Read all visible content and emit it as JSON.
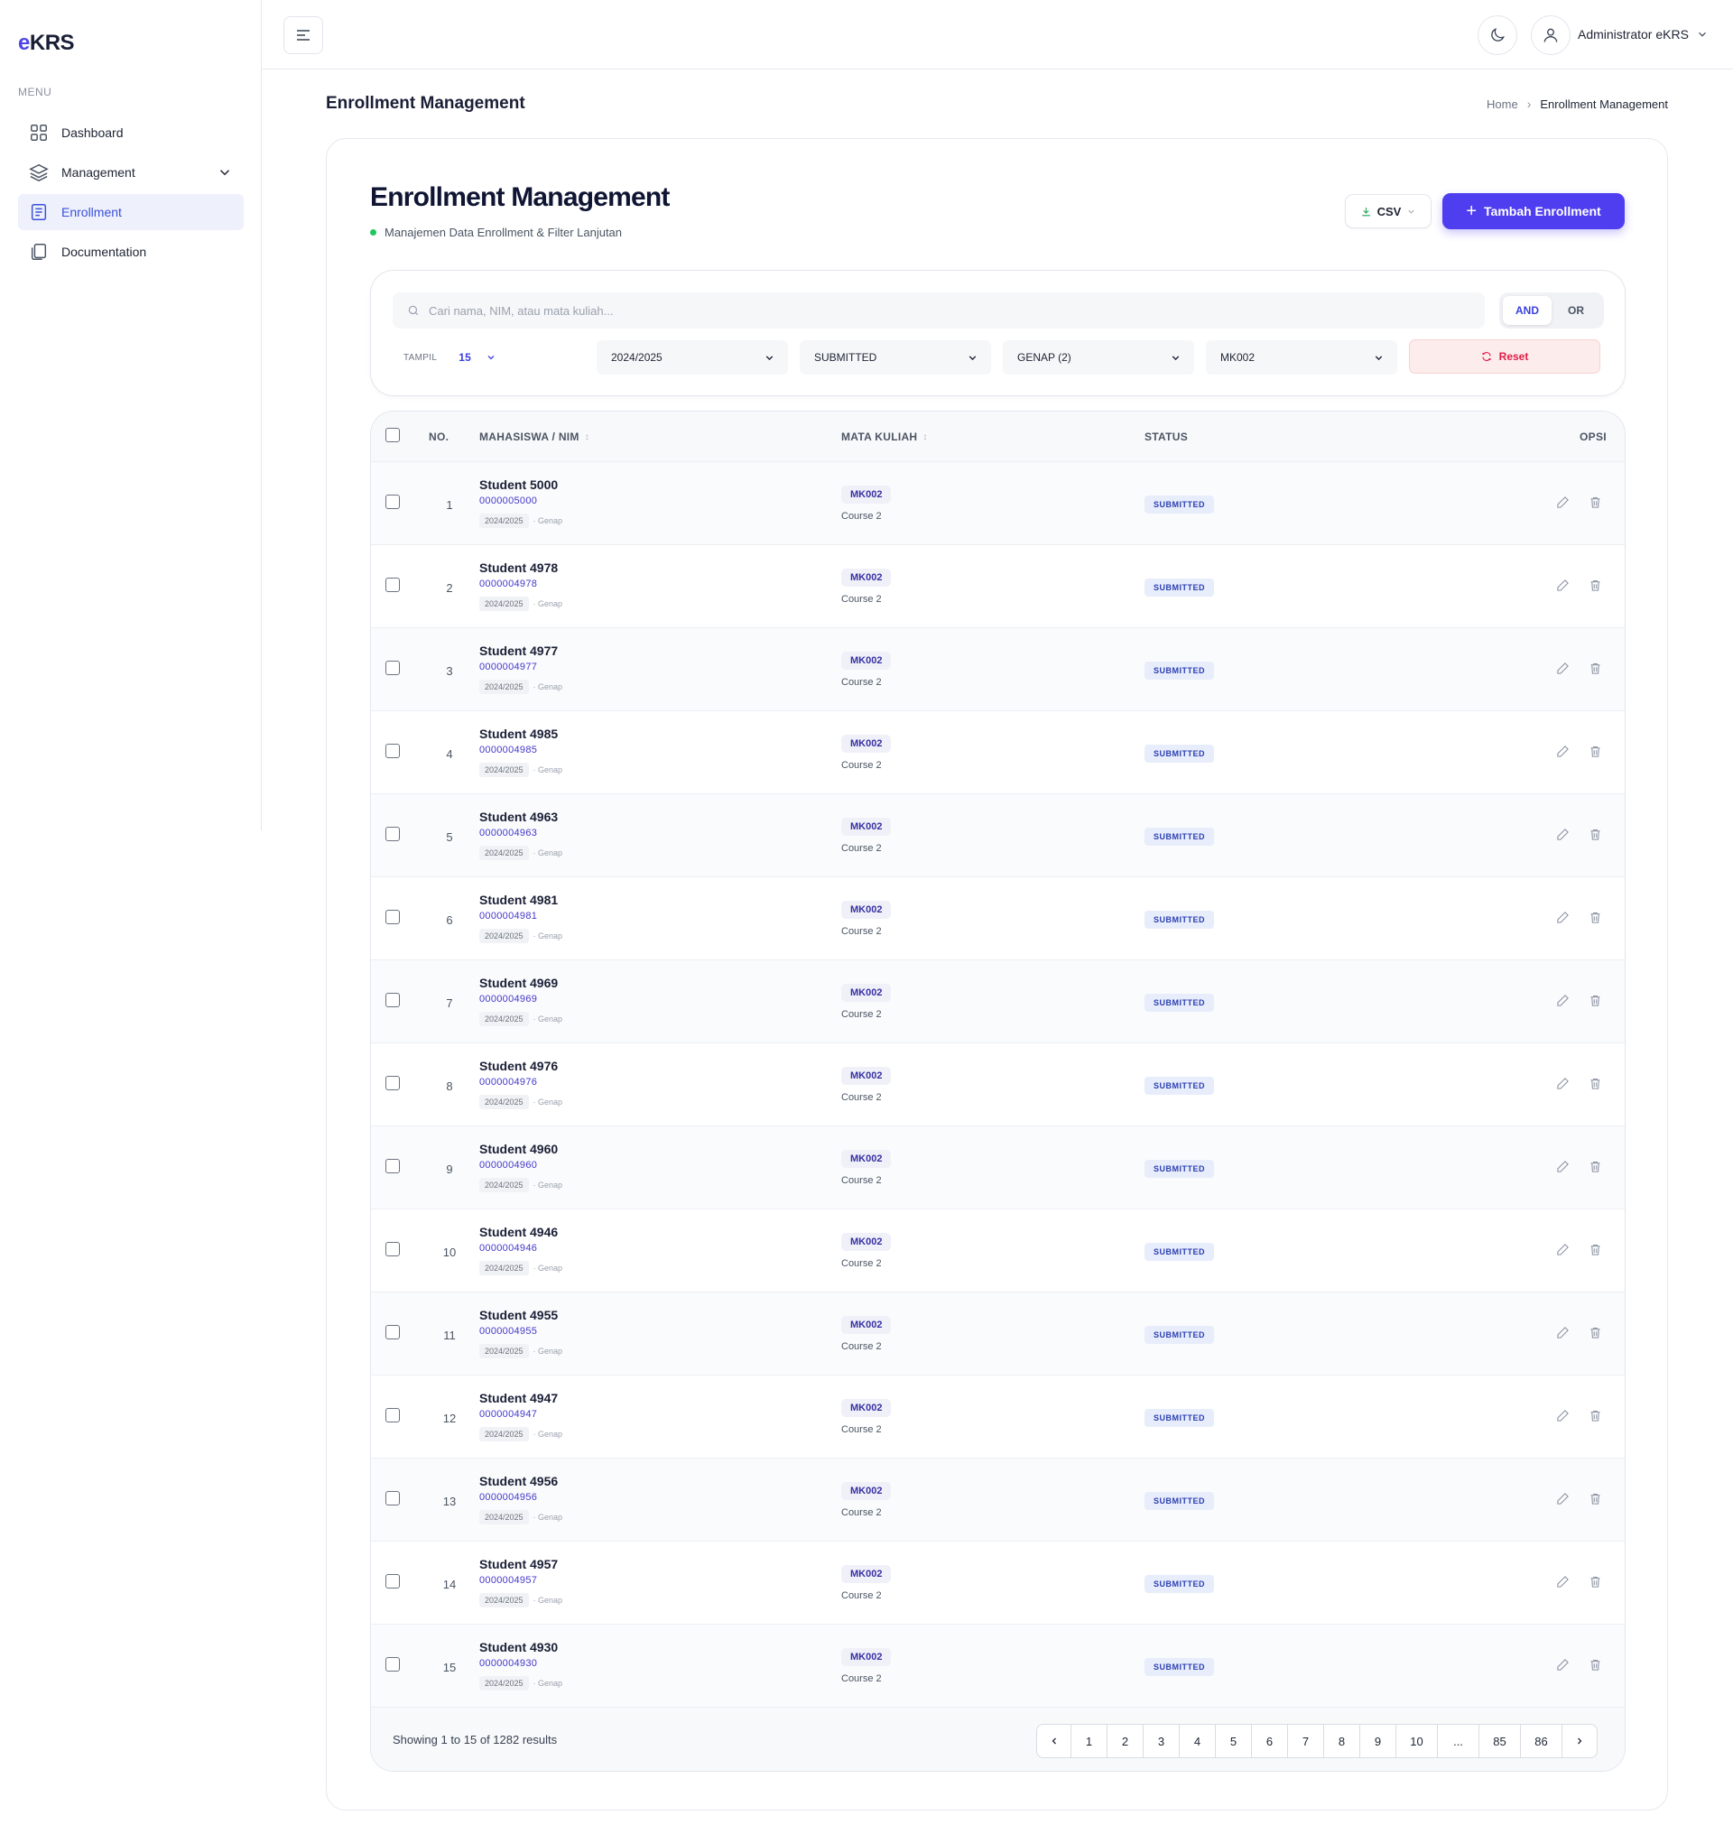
{
  "app": {
    "logo_prefix": "e",
    "logo_rest": "KRS"
  },
  "sidebar": {
    "menu_label": "MENU",
    "items": [
      {
        "label": "Dashboard",
        "icon": "grid-icon"
      },
      {
        "label": "Management",
        "icon": "layers-icon"
      },
      {
        "label": "Enrollment",
        "icon": "list-icon"
      },
      {
        "label": "Documentation",
        "icon": "document-icon"
      }
    ]
  },
  "header": {
    "user_name": "Administrator eKRS"
  },
  "page": {
    "title": "Enrollment Management",
    "breadcrumb": [
      "Home",
      "Enrollment Management"
    ]
  },
  "card": {
    "title": "Enrollment Management",
    "subtitle": "Manajemen Data Enrollment & Filter Lanjutan",
    "csv_label": "CSV",
    "add_label": "Tambah Enrollment"
  },
  "filters": {
    "search_placeholder": "Cari nama, NIM, atau mata kuliah...",
    "logic_and": "AND",
    "logic_or": "OR",
    "tampil_label": "TAMPIL",
    "tampil_value": "15",
    "year": "2024/2025",
    "status": "SUBMITTED",
    "semester": "GENAP (2)",
    "course": "MK002",
    "reset_label": "Reset"
  },
  "table": {
    "columns": {
      "no": "NO.",
      "student": "MAHASISWA / NIM",
      "course": "MATA KULIAH",
      "status": "STATUS",
      "actions": "OPSI"
    },
    "rows": [
      {
        "no": "1",
        "name": "Student 5000",
        "nim": "0000005000",
        "year": "2024/2025",
        "semester": "· Genap",
        "code": "MK002",
        "course": "Course 2",
        "status": "SUBMITTED"
      },
      {
        "no": "2",
        "name": "Student 4978",
        "nim": "0000004978",
        "year": "2024/2025",
        "semester": "· Genap",
        "code": "MK002",
        "course": "Course 2",
        "status": "SUBMITTED"
      },
      {
        "no": "3",
        "name": "Student 4977",
        "nim": "0000004977",
        "year": "2024/2025",
        "semester": "· Genap",
        "code": "MK002",
        "course": "Course 2",
        "status": "SUBMITTED"
      },
      {
        "no": "4",
        "name": "Student 4985",
        "nim": "0000004985",
        "year": "2024/2025",
        "semester": "· Genap",
        "code": "MK002",
        "course": "Course 2",
        "status": "SUBMITTED"
      },
      {
        "no": "5",
        "name": "Student 4963",
        "nim": "0000004963",
        "year": "2024/2025",
        "semester": "· Genap",
        "code": "MK002",
        "course": "Course 2",
        "status": "SUBMITTED"
      },
      {
        "no": "6",
        "name": "Student 4981",
        "nim": "0000004981",
        "year": "2024/2025",
        "semester": "· Genap",
        "code": "MK002",
        "course": "Course 2",
        "status": "SUBMITTED"
      },
      {
        "no": "7",
        "name": "Student 4969",
        "nim": "0000004969",
        "year": "2024/2025",
        "semester": "· Genap",
        "code": "MK002",
        "course": "Course 2",
        "status": "SUBMITTED"
      },
      {
        "no": "8",
        "name": "Student 4976",
        "nim": "0000004976",
        "year": "2024/2025",
        "semester": "· Genap",
        "code": "MK002",
        "course": "Course 2",
        "status": "SUBMITTED"
      },
      {
        "no": "9",
        "name": "Student 4960",
        "nim": "0000004960",
        "year": "2024/2025",
        "semester": "· Genap",
        "code": "MK002",
        "course": "Course 2",
        "status": "SUBMITTED"
      },
      {
        "no": "10",
        "name": "Student 4946",
        "nim": "0000004946",
        "year": "2024/2025",
        "semester": "· Genap",
        "code": "MK002",
        "course": "Course 2",
        "status": "SUBMITTED"
      },
      {
        "no": "11",
        "name": "Student 4955",
        "nim": "0000004955",
        "year": "2024/2025",
        "semester": "· Genap",
        "code": "MK002",
        "course": "Course 2",
        "status": "SUBMITTED"
      },
      {
        "no": "12",
        "name": "Student 4947",
        "nim": "0000004947",
        "year": "2024/2025",
        "semester": "· Genap",
        "code": "MK002",
        "course": "Course 2",
        "status": "SUBMITTED"
      },
      {
        "no": "13",
        "name": "Student 4956",
        "nim": "0000004956",
        "year": "2024/2025",
        "semester": "· Genap",
        "code": "MK002",
        "course": "Course 2",
        "status": "SUBMITTED"
      },
      {
        "no": "14",
        "name": "Student 4957",
        "nim": "0000004957",
        "year": "2024/2025",
        "semester": "· Genap",
        "code": "MK002",
        "course": "Course 2",
        "status": "SUBMITTED"
      },
      {
        "no": "15",
        "name": "Student 4930",
        "nim": "0000004930",
        "year": "2024/2025",
        "semester": "· Genap",
        "code": "MK002",
        "course": "Course 2",
        "status": "SUBMITTED"
      }
    ]
  },
  "pagination": {
    "summary": "Showing 1 to 15 of 1282 results",
    "pages": [
      "1",
      "2",
      "3",
      "4",
      "5",
      "6",
      "7",
      "8",
      "9",
      "10",
      "...",
      "85",
      "86"
    ]
  },
  "colors": {
    "accent": "#4f3df0",
    "active_nav_bg": "#eef1fb",
    "status_bg": "#e8edfb",
    "reset_bg": "#fdecec"
  }
}
